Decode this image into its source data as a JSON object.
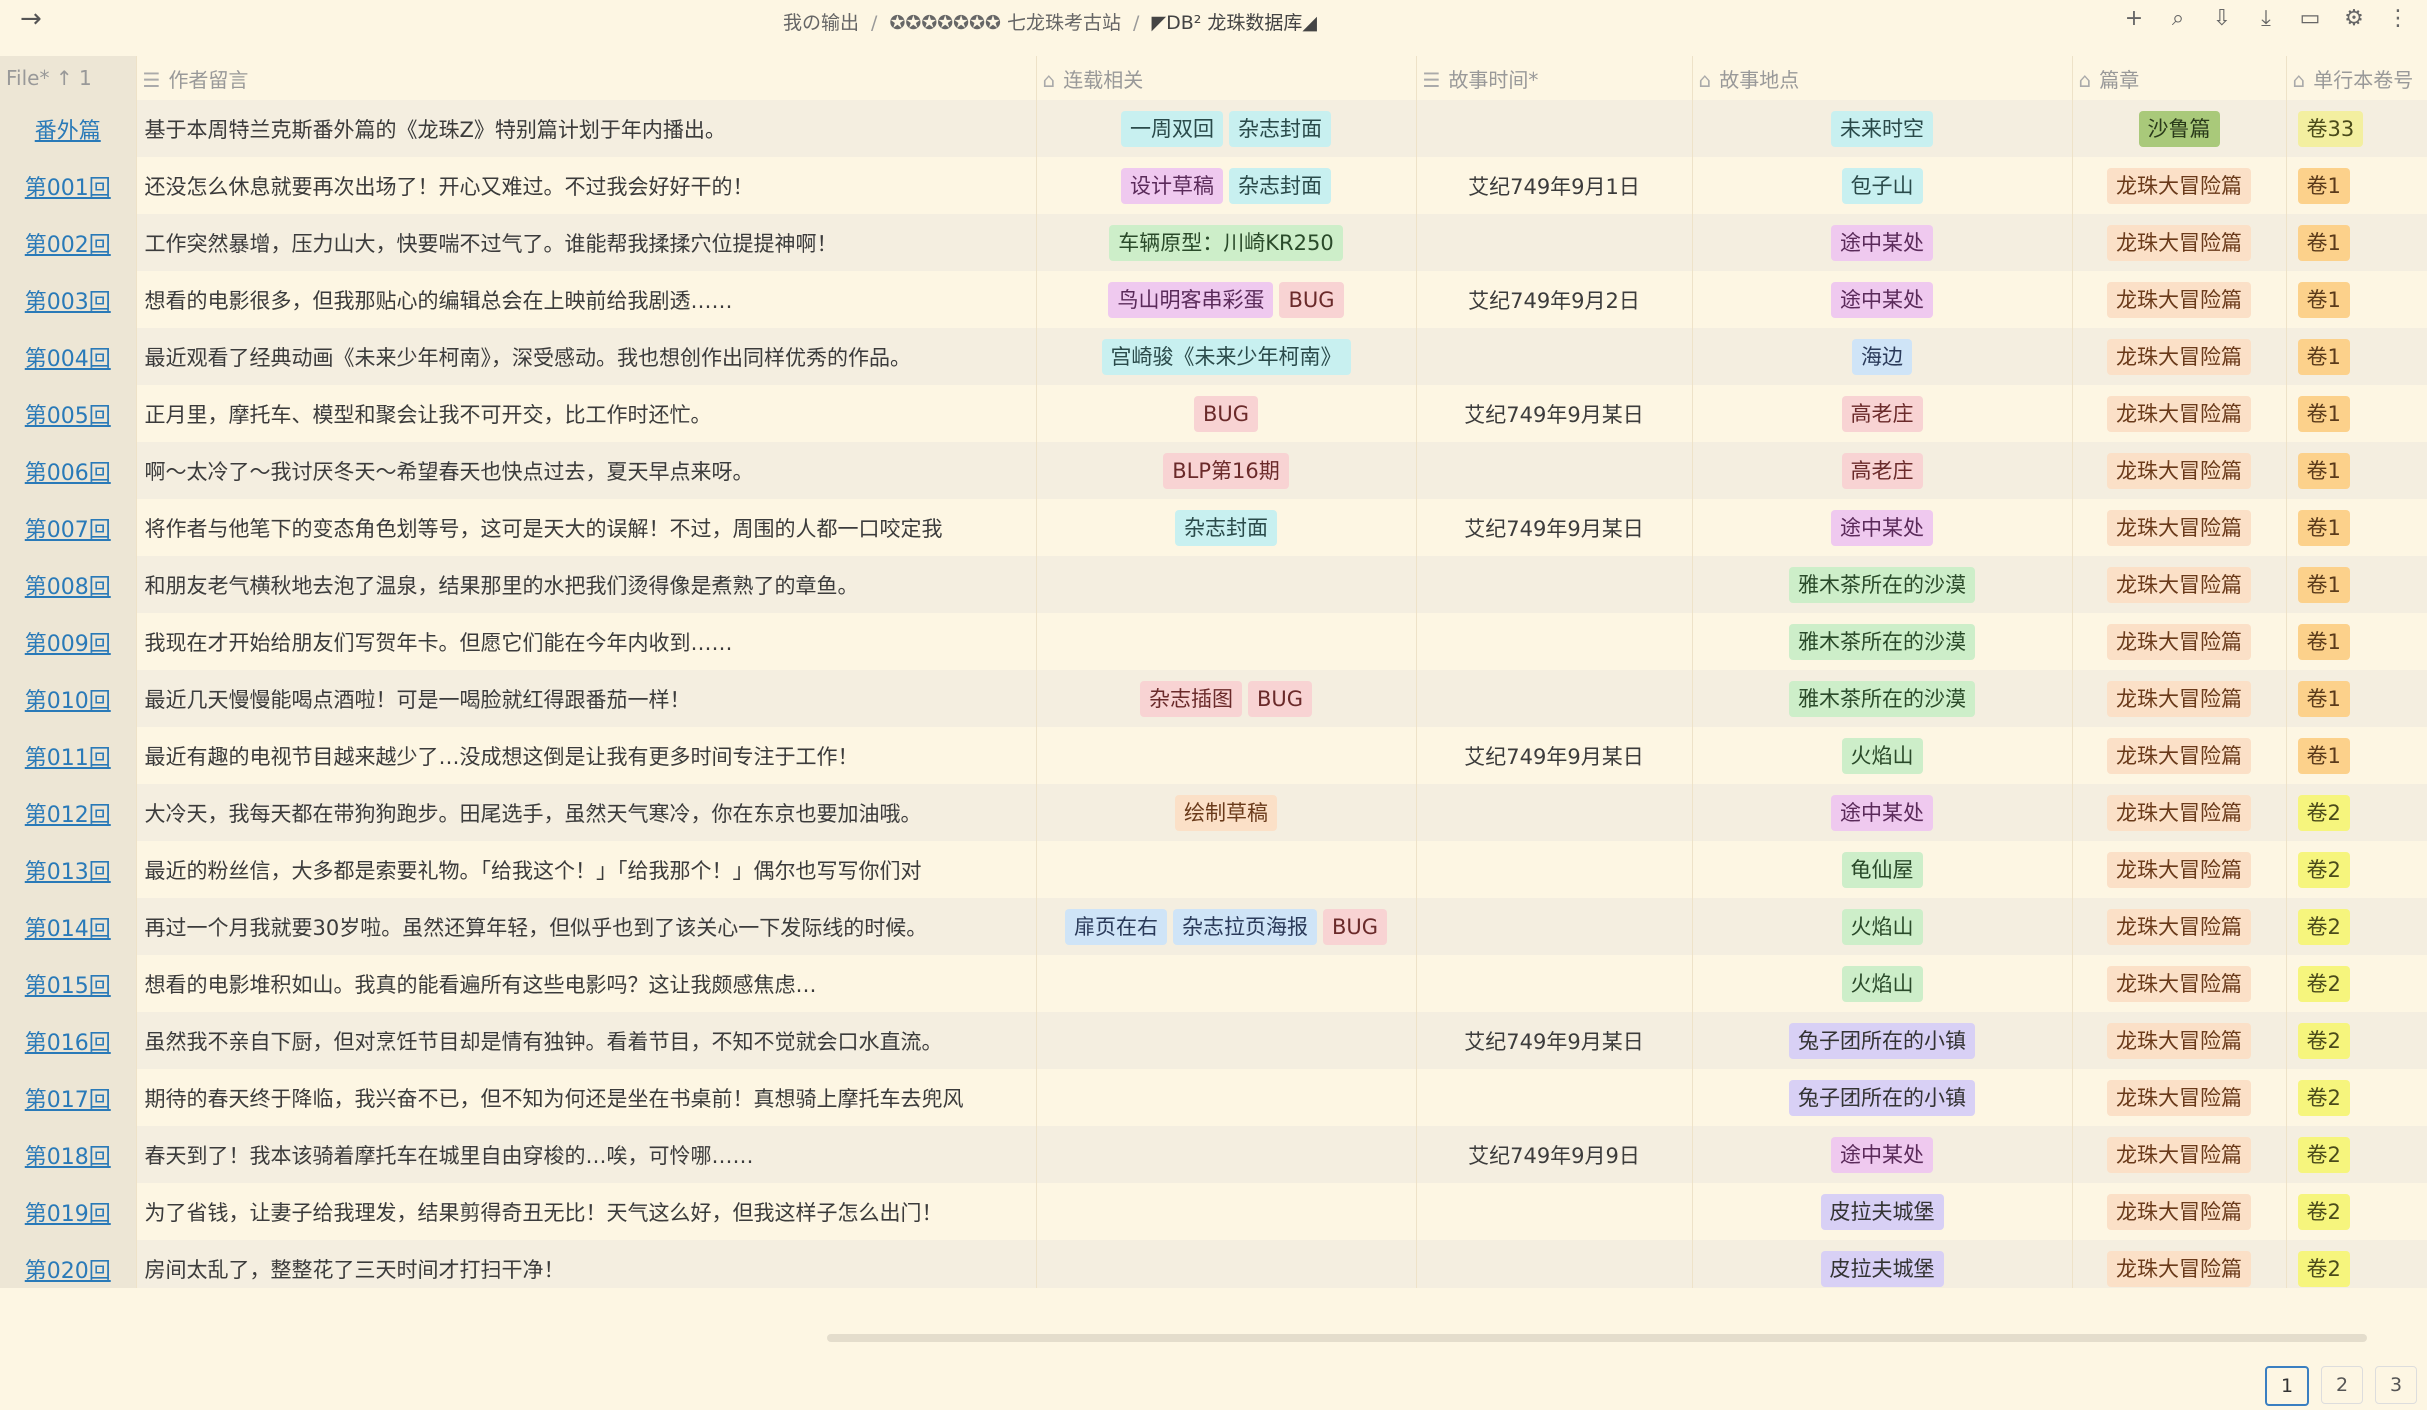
{
  "topbar": {
    "back_icon": "→",
    "crumb1": "我の输出",
    "crumb2": "✪✪✪✪✪✪✪ 七龙珠考古站",
    "crumb3": "◤DB² 龙珠数据库◢",
    "sep": "/"
  },
  "tools": [
    "+",
    "⌕",
    "⇩",
    "⤓",
    "▭",
    "⚙",
    "⋮"
  ],
  "headers": {
    "file": "File* ↑ 1",
    "note": "作者留言",
    "serial": "连载相关",
    "time": "故事时间*",
    "place": "故事地点",
    "arc": "篇章",
    "vol": "单行本卷号"
  },
  "rows": [
    {
      "file": "番外篇",
      "note": "基于本周特兰克斯番外篇的《龙珠Z》特别篇计划于年内播出。",
      "serial": [
        {
          "t": "一周双回",
          "c": "t-cyan"
        },
        {
          "t": "杂志封面",
          "c": "t-cyan"
        }
      ],
      "time": "",
      "place": {
        "t": "未来时空",
        "c": "t-cyan"
      },
      "arc": {
        "t": "沙鲁篇",
        "c": "t-olive"
      },
      "vol": {
        "t": "卷33",
        "c": "t-yellow"
      }
    },
    {
      "file": "第001回",
      "note": "还没怎么休息就要再次出场了！开心又难过。不过我会好好干的！",
      "serial": [
        {
          "t": "设计草稿",
          "c": "t-purple"
        },
        {
          "t": "杂志封面",
          "c": "t-cyan"
        }
      ],
      "time": "艾纪749年9月1日",
      "place": {
        "t": "包子山",
        "c": "t-cyan"
      },
      "arc": {
        "t": "龙珠大冒险篇",
        "c": "t-peach"
      },
      "vol": {
        "t": "卷1",
        "c": "t-orange"
      }
    },
    {
      "file": "第002回",
      "note": "工作突然暴增，压力山大，快要喘不过气了。谁能帮我揉揉穴位提提神啊！",
      "serial": [
        {
          "t": "车辆原型：川崎KR250",
          "c": "t-green"
        }
      ],
      "time": "",
      "place": {
        "t": "途中某处",
        "c": "t-purple"
      },
      "arc": {
        "t": "龙珠大冒险篇",
        "c": "t-peach"
      },
      "vol": {
        "t": "卷1",
        "c": "t-orange"
      }
    },
    {
      "file": "第003回",
      "note": "想看的电影很多，但我那贴心的编辑总会在上映前给我剧透……",
      "serial": [
        {
          "t": "鸟山明客串彩蛋",
          "c": "t-purple"
        },
        {
          "t": "BUG",
          "c": "t-pink"
        }
      ],
      "time": "艾纪749年9月2日",
      "place": {
        "t": "途中某处",
        "c": "t-purple"
      },
      "arc": {
        "t": "龙珠大冒险篇",
        "c": "t-peach"
      },
      "vol": {
        "t": "卷1",
        "c": "t-orange"
      }
    },
    {
      "file": "第004回",
      "note": "最近观看了经典动画《未来少年柯南》，深受感动。我也想创作出同样优秀的作品。",
      "serial": [
        {
          "t": "宫崎骏《未来少年柯南》",
          "c": "t-cyan"
        }
      ],
      "time": "",
      "place": {
        "t": "海边",
        "c": "t-blue"
      },
      "arc": {
        "t": "龙珠大冒险篇",
        "c": "t-peach"
      },
      "vol": {
        "t": "卷1",
        "c": "t-orange"
      }
    },
    {
      "file": "第005回",
      "note": "正月里，摩托车、模型和聚会让我不可开交，比工作时还忙。",
      "serial": [
        {
          "t": "BUG",
          "c": "t-pink"
        }
      ],
      "time": "艾纪749年9月某日",
      "place": {
        "t": "高老庄",
        "c": "t-pink"
      },
      "arc": {
        "t": "龙珠大冒险篇",
        "c": "t-peach"
      },
      "vol": {
        "t": "卷1",
        "c": "t-orange"
      }
    },
    {
      "file": "第006回",
      "note": "啊～太冷了～我讨厌冬天～希望春天也快点过去，夏天早点来呀。",
      "serial": [
        {
          "t": "BLP第16期",
          "c": "t-pink"
        }
      ],
      "time": "",
      "place": {
        "t": "高老庄",
        "c": "t-pink"
      },
      "arc": {
        "t": "龙珠大冒险篇",
        "c": "t-peach"
      },
      "vol": {
        "t": "卷1",
        "c": "t-orange"
      }
    },
    {
      "file": "第007回",
      "note": "将作者与他笔下的变态角色划等号，这可是天大的误解！不过，周围的人都一口咬定我",
      "serial": [
        {
          "t": "杂志封面",
          "c": "t-cyan"
        }
      ],
      "time": "艾纪749年9月某日",
      "place": {
        "t": "途中某处",
        "c": "t-purple"
      },
      "arc": {
        "t": "龙珠大冒险篇",
        "c": "t-peach"
      },
      "vol": {
        "t": "卷1",
        "c": "t-orange"
      }
    },
    {
      "file": "第008回",
      "note": "和朋友老气横秋地去泡了温泉，结果那里的水把我们烫得像是煮熟了的章鱼。",
      "serial": [],
      "time": "",
      "place": {
        "t": "雅木茶所在的沙漠",
        "c": "t-green"
      },
      "arc": {
        "t": "龙珠大冒险篇",
        "c": "t-peach"
      },
      "vol": {
        "t": "卷1",
        "c": "t-orange"
      }
    },
    {
      "file": "第009回",
      "note": "我现在才开始给朋友们写贺年卡。但愿它们能在今年内收到……",
      "serial": [],
      "time": "",
      "place": {
        "t": "雅木茶所在的沙漠",
        "c": "t-green"
      },
      "arc": {
        "t": "龙珠大冒险篇",
        "c": "t-peach"
      },
      "vol": {
        "t": "卷1",
        "c": "t-orange"
      }
    },
    {
      "file": "第010回",
      "note": "最近几天慢慢能喝点酒啦！可是一喝脸就红得跟番茄一样！",
      "serial": [
        {
          "t": "杂志插图",
          "c": "t-pink"
        },
        {
          "t": "BUG",
          "c": "t-pink"
        }
      ],
      "time": "",
      "place": {
        "t": "雅木茶所在的沙漠",
        "c": "t-green"
      },
      "arc": {
        "t": "龙珠大冒险篇",
        "c": "t-peach"
      },
      "vol": {
        "t": "卷1",
        "c": "t-orange"
      }
    },
    {
      "file": "第011回",
      "note": "最近有趣的电视节目越来越少了…没成想这倒是让我有更多时间专注于工作！",
      "serial": [],
      "time": "艾纪749年9月某日",
      "place": {
        "t": "火焰山",
        "c": "t-green"
      },
      "arc": {
        "t": "龙珠大冒险篇",
        "c": "t-peach"
      },
      "vol": {
        "t": "卷1",
        "c": "t-orange"
      }
    },
    {
      "file": "第012回",
      "note": "大冷天，我每天都在带狗狗跑步。田尾选手，虽然天气寒冷，你在东京也要加油哦。",
      "serial": [
        {
          "t": "绘制草稿",
          "c": "t-peach"
        }
      ],
      "time": "",
      "place": {
        "t": "途中某处",
        "c": "t-purple"
      },
      "arc": {
        "t": "龙珠大冒险篇",
        "c": "t-peach"
      },
      "vol": {
        "t": "卷2",
        "c": "t-vol-yellow"
      }
    },
    {
      "file": "第013回",
      "note": "最近的粉丝信，大多都是索要礼物。「给我这个！」「给我那个！」偶尔也写写你们对",
      "serial": [],
      "time": "",
      "place": {
        "t": "龟仙屋",
        "c": "t-green"
      },
      "arc": {
        "t": "龙珠大冒险篇",
        "c": "t-peach"
      },
      "vol": {
        "t": "卷2",
        "c": "t-vol-yellow"
      }
    },
    {
      "file": "第014回",
      "note": "再过一个月我就要30岁啦。虽然还算年轻，但似乎也到了该关心一下发际线的时候。",
      "serial": [
        {
          "t": "扉页在右",
          "c": "t-blue"
        },
        {
          "t": "杂志拉页海报",
          "c": "t-blue"
        },
        {
          "t": "BUG",
          "c": "t-pink"
        }
      ],
      "time": "",
      "place": {
        "t": "火焰山",
        "c": "t-green"
      },
      "arc": {
        "t": "龙珠大冒险篇",
        "c": "t-peach"
      },
      "vol": {
        "t": "卷2",
        "c": "t-vol-yellow"
      }
    },
    {
      "file": "第015回",
      "note": "想看的电影堆积如山。我真的能看遍所有这些电影吗？这让我颇感焦虑…",
      "serial": [],
      "time": "",
      "place": {
        "t": "火焰山",
        "c": "t-green"
      },
      "arc": {
        "t": "龙珠大冒险篇",
        "c": "t-peach"
      },
      "vol": {
        "t": "卷2",
        "c": "t-vol-yellow"
      }
    },
    {
      "file": "第016回",
      "note": "虽然我不亲自下厨，但对烹饪节目却是情有独钟。看着节目，不知不觉就会口水直流。",
      "serial": [],
      "time": "艾纪749年9月某日",
      "place": {
        "t": "兔子团所在的小镇",
        "c": "t-lavender"
      },
      "arc": {
        "t": "龙珠大冒险篇",
        "c": "t-peach"
      },
      "vol": {
        "t": "卷2",
        "c": "t-vol-yellow"
      }
    },
    {
      "file": "第017回",
      "note": "期待的春天终于降临，我兴奋不已，但不知为何还是坐在书桌前！真想骑上摩托车去兜风",
      "serial": [],
      "time": "",
      "place": {
        "t": "兔子团所在的小镇",
        "c": "t-lavender"
      },
      "arc": {
        "t": "龙珠大冒险篇",
        "c": "t-peach"
      },
      "vol": {
        "t": "卷2",
        "c": "t-vol-yellow"
      }
    },
    {
      "file": "第018回",
      "note": "春天到了！我本该骑着摩托车在城里自由穿梭的…唉，可怜哪……",
      "serial": [],
      "time": "艾纪749年9月9日",
      "place": {
        "t": "途中某处",
        "c": "t-purple"
      },
      "arc": {
        "t": "龙珠大冒险篇",
        "c": "t-peach"
      },
      "vol": {
        "t": "卷2",
        "c": "t-vol-yellow"
      }
    },
    {
      "file": "第019回",
      "note": "为了省钱，让妻子给我理发，结果剪得奇丑无比！天气这么好，但我这样子怎么出门！",
      "serial": [],
      "time": "",
      "place": {
        "t": "皮拉夫城堡",
        "c": "t-lavender"
      },
      "arc": {
        "t": "龙珠大冒险篇",
        "c": "t-peach"
      },
      "vol": {
        "t": "卷2",
        "c": "t-vol-yellow"
      }
    },
    {
      "file": "第020回",
      "note": "房间太乱了，整整花了三天时间才打扫干净！",
      "serial": [],
      "time": "",
      "place": {
        "t": "皮拉夫城堡",
        "c": "t-lavender"
      },
      "arc": {
        "t": "龙珠大冒险篇",
        "c": "t-peach"
      },
      "vol": {
        "t": "卷2",
        "c": "t-vol-yellow"
      }
    }
  ],
  "pager": [
    "1",
    "2",
    "3"
  ]
}
